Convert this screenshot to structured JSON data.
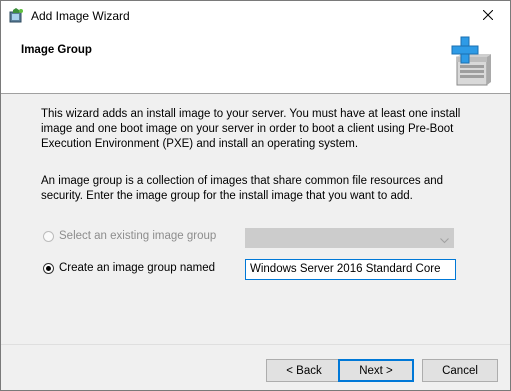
{
  "window": {
    "title": "Add Image Wizard",
    "icon": "wds-wizard-icon",
    "close_icon": "close-icon"
  },
  "header": {
    "title": "Image Group",
    "icon": "server-add-icon"
  },
  "content": {
    "intro": "This wizard adds an install image to your server. You must have at least one install image and one boot image on your server in order to boot a client using Pre-Boot Execution Environment (PXE) and install an operating system.",
    "description": "An image group is a collection of images that share common file resources and security. Enter the image group for the install image that you want to add.",
    "option_existing": {
      "label": "Select an existing image group",
      "selected": false,
      "enabled": false,
      "dropdown_value": ""
    },
    "option_new": {
      "label": "Create an image group named",
      "selected": true,
      "enabled": true,
      "value": "Windows Server 2016 Standard Core"
    }
  },
  "buttons": {
    "back": "< Back",
    "next": "Next >",
    "cancel": "Cancel"
  },
  "colors": {
    "accent": "#0078d7",
    "icon_plus": "#2e9be6"
  }
}
